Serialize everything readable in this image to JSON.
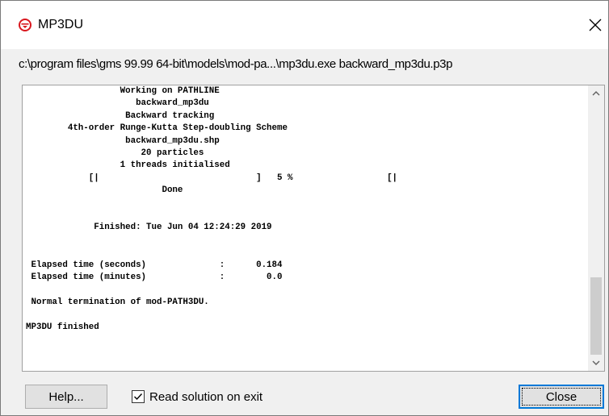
{
  "window": {
    "title": "MP3DU",
    "command_line": "c:\\program files\\gms 99.99 64-bit\\models\\mod-pa...\\mp3du.exe backward_mp3du.p3p"
  },
  "output": {
    "text": "                  Working on PATHLINE\n                     backward_mp3du\n                   Backward tracking\n        4th-order Runge-Kutta Step-doubling Scheme\n                   backward_mp3du.shp\n                      20 particles\n                  1 threads initialised\n            [|                              ]   5 %                  [|\n                          Done\n\n\n             Finished: Tue Jun 04 12:24:29 2019\n\n\n Elapsed time (seconds)              :      0.184\n Elapsed time (minutes)              :        0.0\n\n Normal termination of mod-PATH3DU.\n\nMP3DU finished"
  },
  "footer": {
    "help_label": "Help...",
    "read_solution_label": "Read solution on exit",
    "read_solution_checked": true,
    "close_label": "Close"
  },
  "icons": {
    "app": "mp3du-app-icon",
    "close": "close-icon",
    "scroll_up": "chevron-up-icon",
    "scroll_down": "chevron-down-icon",
    "check": "checkmark-icon"
  },
  "colors": {
    "app_icon_red": "#d9181f",
    "focus_blue": "#0078d7",
    "dialog_bg": "#f0f0f0"
  }
}
